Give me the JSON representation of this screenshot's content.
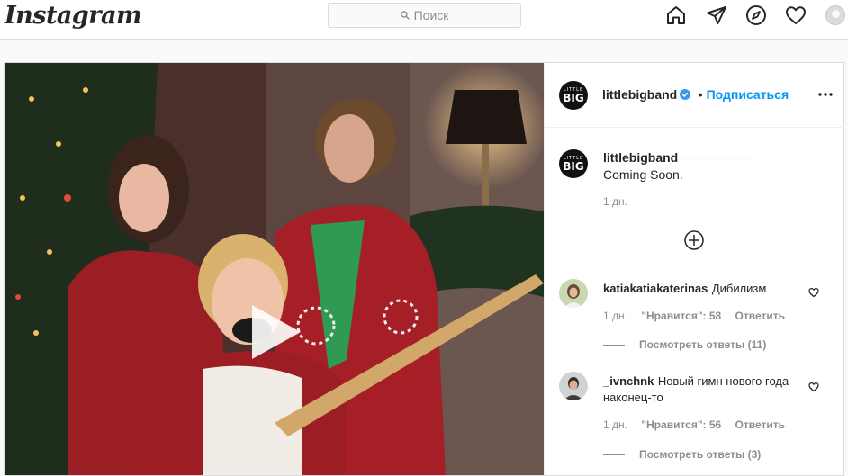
{
  "header": {
    "logo": "Instagram",
    "search_placeholder": "Поиск"
  },
  "post": {
    "author": "littlebigband",
    "avatar_text_top": "LITTLE",
    "avatar_text_main": "BIG",
    "separator": "•",
    "follow_label": "Подписаться",
    "caption": {
      "author": "littlebigband",
      "blurred_text": "· · · · · · · · · · ·",
      "text": "Coming Soon.",
      "age": "1 дн."
    },
    "comments": [
      {
        "user": "katiakatiakaterinas",
        "text": "Дибилизм",
        "age": "1 дн.",
        "likes": "\"Нравится\": 58",
        "reply_label": "Ответить",
        "view_replies": "Посмотреть ответы (11)"
      },
      {
        "user": "_ivnchnk",
        "text": "Новый гимн нового года наконец-то",
        "age": "1 дн.",
        "likes": "\"Нравится\": 56",
        "reply_label": "Ответить",
        "view_replies": "Посмотреть ответы (3)"
      }
    ]
  },
  "colors": {
    "link": "#0095f6",
    "border": "#dbdbdb",
    "muted": "#8e8e8e"
  },
  "icons": [
    "search-icon",
    "home-icon",
    "direct-icon",
    "explore-icon",
    "activity-heart-icon",
    "profile-avatar",
    "verified-icon",
    "more-options-icon",
    "load-more-icon",
    "play-icon",
    "like-comment-icon"
  ]
}
